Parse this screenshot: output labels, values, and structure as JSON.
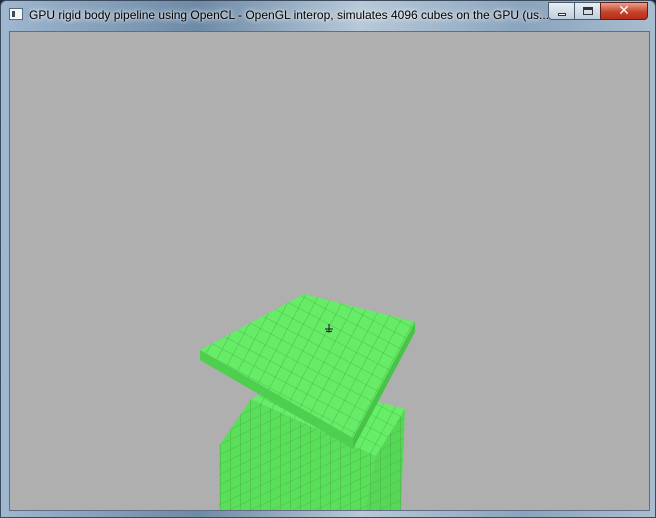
{
  "window": {
    "title": "GPU rigid body pipeline using OpenCL - OpenGL interop, simulates 4096 cubes on the GPU (us...",
    "app_icon": "window-icon",
    "buttons": {
      "minimize_icon": "minimize-icon",
      "maximize_icon": "maximize-icon",
      "close_icon": "close-icon"
    }
  },
  "viewport": {
    "background_color": "#afafaf",
    "cube_color": "#5fe85f",
    "grid_line_color": "#3f9a3f",
    "cursor_icon": "crosshair-cursor-icon"
  }
}
